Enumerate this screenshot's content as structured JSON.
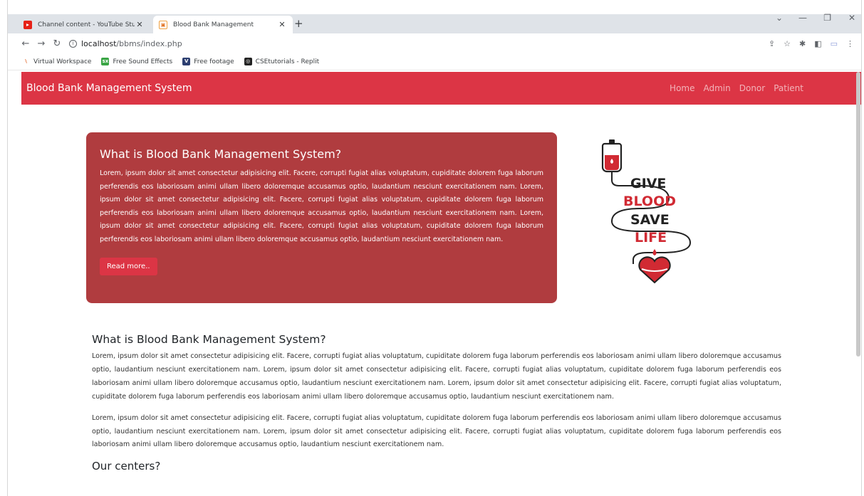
{
  "browser": {
    "tabs": [
      {
        "title": "Channel content - YouTube Studi",
        "active": false
      },
      {
        "title": "Blood Bank Management",
        "active": true
      }
    ],
    "new_tab": "+",
    "url_host": "localhost",
    "url_path": "/bbms/index.php",
    "bookmarks": [
      {
        "label": "Virtual Workspace",
        "icon": "virtual-workspace-icon"
      },
      {
        "label": "Free Sound Effects",
        "icon": "sound-effects-icon"
      },
      {
        "label": "Free footage",
        "icon": "footage-icon"
      },
      {
        "label": "CSEtutorials - Replit",
        "icon": "replit-icon"
      }
    ]
  },
  "site": {
    "brand": "Blood Bank Management System",
    "nav": [
      "Home",
      "Admin",
      "Donor",
      "Patient"
    ],
    "accent": "#dc3545",
    "hero": {
      "title": "What is Blood Bank Management System?",
      "text": "Lorem, ipsum dolor sit amet consectetur adipisicing elit. Facere, corrupti fugiat alias voluptatum, cupiditate dolorem fuga laborum perferendis eos laboriosam animi ullam libero doloremque accusamus optio, laudantium nesciunt exercitationem nam. Lorem, ipsum dolor sit amet consectetur adipisicing elit. Facere, corrupti fugiat alias voluptatum, cupiditate dolorem fuga laborum perferendis eos laboriosam animi ullam libero doloremque accusamus optio, laudantium nesciunt exercitationem nam. Lorem, ipsum dolor sit amet consectetur adipisicing elit. Facere, corrupti fugiat alias voluptatum, cupiditate dolorem fuga laborum perferendis eos laboriosam animi ullam libero doloremque accusamus optio, laudantium nesciunt exercitationem nam.",
      "button": "Read more.."
    },
    "logo": {
      "line1": "GIVE",
      "line2": "BLOOD",
      "line3": "SAVE",
      "line4": "LIFE"
    },
    "section": {
      "title": "What is Blood Bank Management System?",
      "para1": "Lorem, ipsum dolor sit amet consectetur adipisicing elit. Facere, corrupti fugiat alias voluptatum, cupiditate dolorem fuga laborum perferendis eos laboriosam animi ullam libero doloremque accusamus optio, laudantium nesciunt exercitationem nam. Lorem, ipsum dolor sit amet consectetur adipisicing elit. Facere, corrupti fugiat alias voluptatum, cupiditate dolorem fuga laborum perferendis eos laboriosam animi ullam libero doloremque accusamus optio, laudantium nesciunt exercitationem nam. Lorem, ipsum dolor sit amet consectetur adipisicing elit. Facere, corrupti fugiat alias voluptatum, cupiditate dolorem fuga laborum perferendis eos laboriosam animi ullam libero doloremque accusamus optio, laudantium nesciunt exercitationem nam.",
      "para2": "Lorem, ipsum dolor sit amet consectetur adipisicing elit. Facere, corrupti fugiat alias voluptatum, cupiditate dolorem fuga laborum perferendis eos laboriosam animi ullam libero doloremque accusamus optio, laudantium nesciunt exercitationem nam. Lorem, ipsum dolor sit amet consectetur adipisicing elit. Facere, corrupti fugiat alias voluptatum, cupiditate dolorem fuga laborum perferendis eos laboriosam animi ullam libero doloremque accusamus optio, laudantium nesciunt exercitationem nam.",
      "subtitle": "Our centers?"
    }
  }
}
